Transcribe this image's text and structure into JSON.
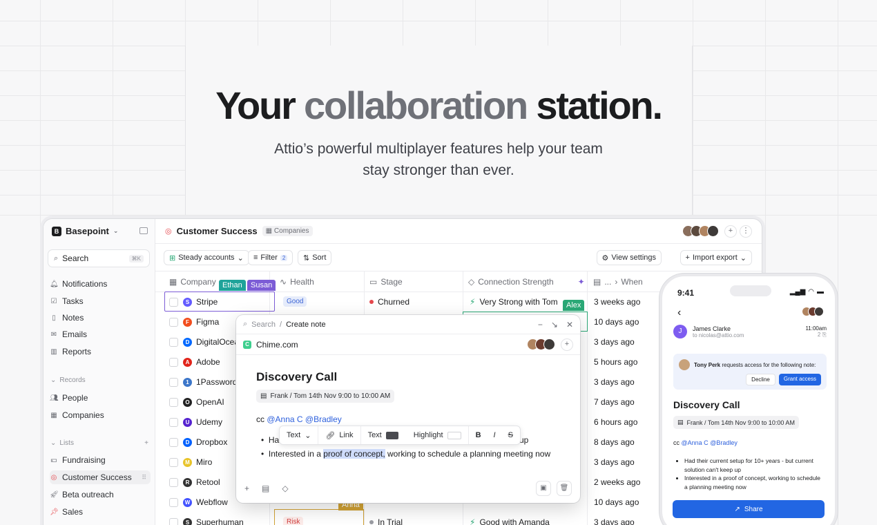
{
  "hero": {
    "title_part1": "Your",
    "title_part2": "collaboration",
    "title_part3": "station.",
    "subtitle_line1": "Attio’s powerful multiplayer features help your team",
    "subtitle_line2": "stay stronger than ever."
  },
  "sidebar": {
    "workspace": "Basepoint",
    "search_label": "Search",
    "search_shortcut": "⌘K",
    "items": [
      {
        "label": "Notifications",
        "icon": "bell-icon"
      },
      {
        "label": "Tasks",
        "icon": "check-square-icon"
      },
      {
        "label": "Notes",
        "icon": "note-icon"
      },
      {
        "label": "Emails",
        "icon": "mail-icon"
      },
      {
        "label": "Reports",
        "icon": "chart-icon"
      }
    ],
    "records_label": "Records",
    "records": [
      {
        "label": "People",
        "icon": "people-icon"
      },
      {
        "label": "Companies",
        "icon": "building-icon"
      }
    ],
    "lists_label": "Lists",
    "lists": [
      {
        "label": "Fundraising",
        "icon": "money-icon"
      },
      {
        "label": "Customer Success",
        "icon": "target-icon"
      },
      {
        "label": "Beta outreach",
        "icon": "rocket-icon"
      },
      {
        "label": "Sales",
        "icon": "pin-icon"
      }
    ]
  },
  "main": {
    "title": "Customer Success",
    "crumb": "Companies",
    "view": "Steady accounts",
    "filter": "Filter",
    "filter_count": "2",
    "sort": "Sort",
    "view_settings": "View settings",
    "import_export": "Import export",
    "columns": [
      "Company",
      "Health",
      "Stage",
      "Connection Strength",
      "...",
      "When"
    ],
    "cursors": {
      "ethan": "Ethan",
      "susan": "Susan",
      "alex": "Alex",
      "anna": "Anna"
    },
    "rows": [
      {
        "company": "Stripe",
        "logo": "S",
        "logo_color": "#635bff",
        "health": "Good",
        "stage": "Churned",
        "stage_color": "#e5484d",
        "conn": "Very Strong with Tom",
        "when": "3 weeks ago"
      },
      {
        "company": "Figma",
        "logo": "F",
        "logo_color": "#f24e1e",
        "when": "10 days ago"
      },
      {
        "company": "DigitalOcean",
        "logo": "D",
        "logo_color": "#0069ff",
        "when": "3 days ago"
      },
      {
        "company": "Adobe",
        "logo": "A",
        "logo_color": "#e1251b",
        "when": "5 hours ago"
      },
      {
        "company": "1Password",
        "logo": "1",
        "logo_color": "#3c76c9",
        "when": "3 days ago"
      },
      {
        "company": "OpenAI",
        "logo": "O",
        "logo_color": "#222222",
        "when": "7 days ago"
      },
      {
        "company": "Udemy",
        "logo": "U",
        "logo_color": "#5624d0",
        "when": "6 hours ago"
      },
      {
        "company": "Dropbox",
        "logo": "D",
        "logo_color": "#0061fe",
        "when": "8 days ago"
      },
      {
        "company": "Miro",
        "logo": "M",
        "logo_color": "#e8c42a",
        "when": "3 days ago"
      },
      {
        "company": "Retool",
        "logo": "R",
        "logo_color": "#333333",
        "when": "2 weeks ago"
      },
      {
        "company": "Webflow",
        "logo": "W",
        "logo_color": "#4353ff",
        "when": "10 days ago"
      },
      {
        "company": "Superhuman",
        "logo": "S",
        "logo_color": "#333333",
        "health": "Risk",
        "stage": "In Trial",
        "stage_color": "#9a9ca3",
        "conn": "Good with Amanda",
        "when": "3 days ago"
      }
    ]
  },
  "modal": {
    "search": "Search",
    "crumb": "Create note",
    "company": "Chime.com",
    "title": "Discovery Call",
    "meeting": "Frank / Tom  14th Nov 9:00 to 10:00 AM",
    "cc": "cc",
    "mention1": "@Anna C",
    "mention2": "@Bradley",
    "bullet1_start": "Ha",
    "bullet1_end": "up",
    "bullet2_pre": "Interested in a ",
    "bullet2_hl": "proof of concept,",
    "bullet2_post": " working to schedule a planning meeting now",
    "toolbar": {
      "text": "Text",
      "link": "Link",
      "text_color": "Text",
      "highlight": "Highlight",
      "bold": "B",
      "italic": "I",
      "strike": "S"
    }
  },
  "phone": {
    "time": "9:41",
    "sender": "James Clarke",
    "to": "to nicolas@attio.com",
    "sent_time": "11:00am",
    "attachments": "2 ⎘",
    "requester": "Tony Perk",
    "request_text": "requests access for the following note:",
    "decline": "Decline",
    "grant": "Grant access",
    "title": "Discovery Call",
    "meeting": "Frank / Tom  14th Nov 9:00 to 10:00 AM",
    "cc": "cc",
    "mention1": "@Anna C",
    "mention2": "@Bradley",
    "bullets": [
      "Had their current setup for 10+ years - but current solution can't keep up",
      "Interested in a proof of concept, working to schedule a planning meeting now"
    ],
    "share": "Share"
  },
  "colors": {
    "accent": "#2266e3",
    "ethan": "#1fa39a",
    "susan": "#7c5cd6",
    "alex": "#2aa876",
    "anna": "#d1a234"
  }
}
